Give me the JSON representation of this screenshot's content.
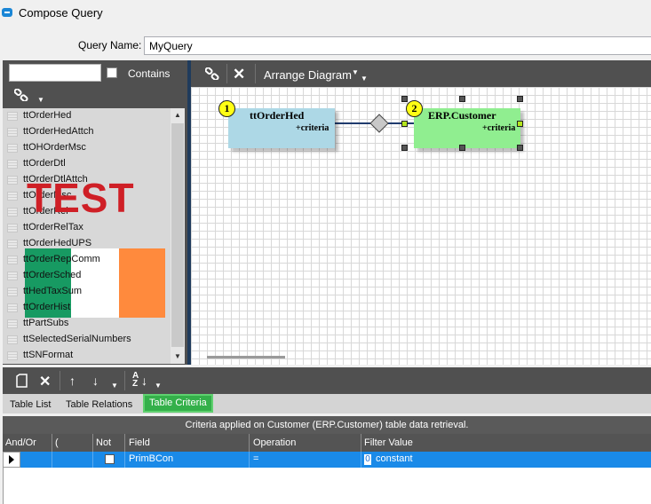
{
  "window": {
    "title": "Compose Query"
  },
  "query": {
    "label": "Query Name:",
    "value": "MyQuery"
  },
  "search": {
    "value": "",
    "contains_label": "Contains"
  },
  "tables": [
    "ttOrderHed",
    "ttOrderHedAttch",
    "ttOHOrderMsc",
    "ttOrderDtl",
    "ttOrderDtlAttch",
    "ttOrderMsc",
    "ttOrderRel",
    "ttOrderRelTax",
    "ttOrderHedUPS",
    "ttOrderRepComm",
    "ttOrderSched",
    "ttHedTaxSum",
    "ttOrderHist",
    "ttPartSubs",
    "ttSelectedSerialNumbers",
    "ttSNFormat"
  ],
  "watermark": {
    "text": "TEST",
    "colors": [
      "#179a62",
      "#ffffff",
      "#ff8a3d"
    ]
  },
  "diagram_toolbar": {
    "arrange_label": "Arrange Diagram"
  },
  "diagram": {
    "nodes": [
      {
        "badge": "1",
        "title": "ttOrderHed",
        "sub": "+criteria",
        "color": "#add8e6"
      },
      {
        "badge": "2",
        "title": "ERP.Customer",
        "sub": "+criteria",
        "color": "#90ee90"
      }
    ]
  },
  "tabs": [
    "Table List",
    "Table Relations",
    "Table Criteria"
  ],
  "criteria": {
    "banner": "Criteria applied on Customer (ERP.Customer)  table data retrieval.",
    "columns": [
      "And/Or",
      "(",
      "Not",
      "Field",
      "Operation",
      "Filter Value"
    ],
    "rows": [
      {
        "andor": "",
        "paren": "",
        "not": false,
        "field": "PrimBCon",
        "operation": "=",
        "filter_value": "constant"
      }
    ]
  },
  "colors": {
    "accent": "#1a8ae8",
    "active_tab": "#34b04a",
    "toolbar": "#505050"
  }
}
